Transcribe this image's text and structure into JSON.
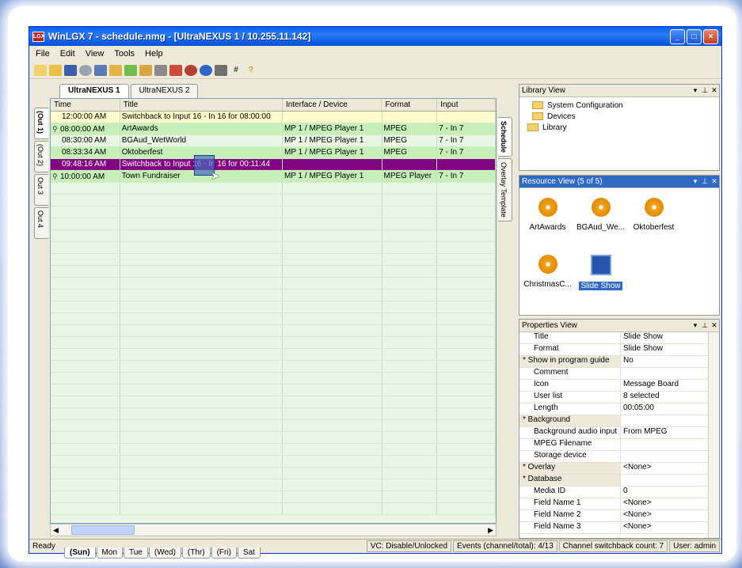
{
  "window": {
    "title": "WinLGX 7 - schedule.nmg - [UltraNEXUS 1 / 10.255.11.142]",
    "app_icon": "LGX"
  },
  "menu": [
    "File",
    "Edit",
    "View",
    "Tools",
    "Help"
  ],
  "channel_tabs": [
    "UltraNEXUS 1",
    "UltraNEXUS 2"
  ],
  "out_tabs": [
    "(Out 1)",
    "(Out 2)",
    "Out 3",
    "Out 4"
  ],
  "right_tabs": [
    "Schedule",
    "Overlay Template"
  ],
  "grid": {
    "headers": [
      "Time",
      "Title",
      "Interface / Device",
      "Format",
      "Input"
    ],
    "rows": [
      {
        "time": "12:00:00 AM",
        "title": "Switchback to Input 16 - In 16 for 08:00:00",
        "iface": "",
        "format": "",
        "input": ""
      },
      {
        "time": "08:00:00 AM",
        "title": "ArtAwards",
        "iface": "MP 1 / MPEG Player 1",
        "format": "MPEG",
        "input": "7 - In 7"
      },
      {
        "time": "08:30:00 AM",
        "title": "BGAud_WetWorld",
        "iface": "MP 1 / MPEG Player 1",
        "format": "MPEG",
        "input": "7 - In 7"
      },
      {
        "time": "08:33:34 AM",
        "title": "Oktoberfest",
        "iface": "MP 1 / MPEG Player 1",
        "format": "MPEG",
        "input": "7 - In 7"
      },
      {
        "time": "09:48:16 AM",
        "title": "Switchback to Input 16 - In 16 for 00:11:44",
        "iface": "",
        "format": "",
        "input": ""
      },
      {
        "time": "10:00:00 AM",
        "title": "Town Fundraiser",
        "iface": "MP 1 / MPEG Player 1",
        "format": "MPEG Player",
        "input": "7 - In 7"
      }
    ]
  },
  "day_tabs": [
    "(Sun)",
    "Mon",
    "Tue",
    "(Wed)",
    "(Thr)",
    "(Fri)",
    "Sat"
  ],
  "library": {
    "title": "Library View",
    "items": [
      "System Configuration",
      "Devices",
      "Library"
    ]
  },
  "resources": {
    "title": "Resource View (5 of 5)",
    "items": [
      "ArtAwards",
      "BGAud_We...",
      "Oktoberfest",
      "ChristmasC...",
      "Slide Show"
    ]
  },
  "properties": {
    "title": "Properties View",
    "rows": [
      {
        "k": "Title",
        "v": "Slide Show"
      },
      {
        "k": "Format",
        "v": "Slide Show"
      },
      {
        "k": "* Show in program guide",
        "v": "No"
      },
      {
        "k": "Comment",
        "v": ""
      },
      {
        "k": "Icon",
        "v": "Message Board"
      },
      {
        "k": "User list",
        "v": "8 selected"
      },
      {
        "k": "Length",
        "v": "00:05:00"
      },
      {
        "k": "* Background",
        "v": ""
      },
      {
        "k": "Background audio input",
        "v": "From MPEG"
      },
      {
        "k": "MPEG Filename",
        "v": ""
      },
      {
        "k": "Storage device",
        "v": ""
      },
      {
        "k": "* Overlay",
        "v": "<None>"
      },
      {
        "k": "* Database",
        "v": ""
      },
      {
        "k": "Media ID",
        "v": "0"
      },
      {
        "k": "Field Name 1",
        "v": "<None>"
      },
      {
        "k": "Field Name 2",
        "v": "<None>"
      },
      {
        "k": "Field Name 3",
        "v": "<None>"
      }
    ]
  },
  "status": {
    "ready": "Ready",
    "vc": "VC: Disable/Unlocked",
    "events": "Events (channel/total): 4/13",
    "switchback": "Channel switchback count: 7",
    "user": "User: admin"
  }
}
